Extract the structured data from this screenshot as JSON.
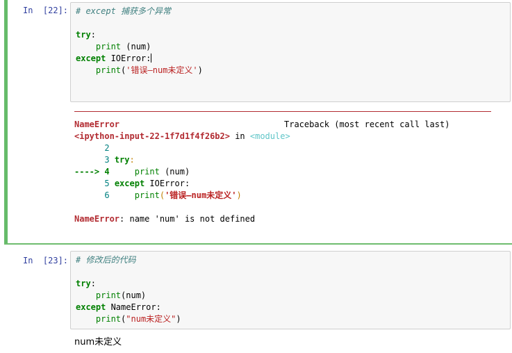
{
  "cells": [
    {
      "prompt": "In  [22]:",
      "code": {
        "comment": "# except 捕获多个异常",
        "kw_try": "try",
        "colon": ":",
        "line2_fn": "print",
        "line2_args": " (num)",
        "kw_except": "except",
        "line3_exc": " IOError:",
        "line4_fn": "print",
        "line4_open": "(",
        "line4_str": "'错误—num未定义'",
        "line4_close": ")"
      },
      "traceback": {
        "error_name": "NameError",
        "header_right": "Traceback (most recent call last)",
        "input_ref": "<ipython-input-22-1f7d1f4f26b2>",
        "in_word": " in ",
        "module": "<module>",
        "lines": [
          {
            "no": "2",
            "text": ""
          },
          {
            "no": "3",
            "kw": "try",
            "rest": ":"
          },
          {
            "arrow": "---->",
            "no": "4",
            "fn": "print",
            "rest": " (num)"
          },
          {
            "no": "5",
            "kw": "except",
            "rest": " IOError:"
          },
          {
            "no": "6",
            "fn": "print",
            "open": "(",
            "str": "'错误—num未定义'",
            "close": ")"
          }
        ],
        "final_error": "NameError",
        "final_message": ": name 'num' is not defined"
      }
    },
    {
      "prompt": "In  [23]:",
      "code": {
        "comment": "# 修改后的代码",
        "kw_try": "try",
        "colon": ":",
        "line2_fn": "print",
        "line2_args": "(num)",
        "kw_except": "except",
        "line3_exc": " NameError:",
        "line4_fn": "print",
        "line4_open": "(",
        "line4_str": "\"num未定义\"",
        "line4_close": ")"
      },
      "output": "num未定义"
    }
  ]
}
